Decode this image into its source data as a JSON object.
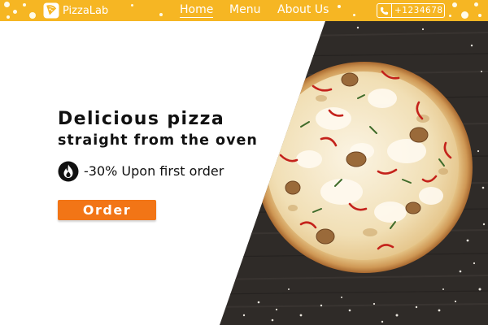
{
  "brand": {
    "name": "PizzaLab",
    "logo_icon": "pizza-slice-icon"
  },
  "nav": {
    "items": [
      {
        "label": "Home",
        "active": true
      },
      {
        "label": "Menu",
        "active": false
      },
      {
        "label": "About Us",
        "active": false
      }
    ]
  },
  "contact": {
    "phone": "+1234678",
    "icon": "phone-icon"
  },
  "hero": {
    "headline": "Delicious pizza",
    "subheadline": "straight from the oven",
    "offer_text": "-30% Upon first order",
    "offer_icon": "fire-icon",
    "order_label": "Order"
  },
  "colors": {
    "topbar": "#f6b623",
    "order_button": "#f27516",
    "heading_text": "#111111",
    "board": "#2f2b28"
  }
}
